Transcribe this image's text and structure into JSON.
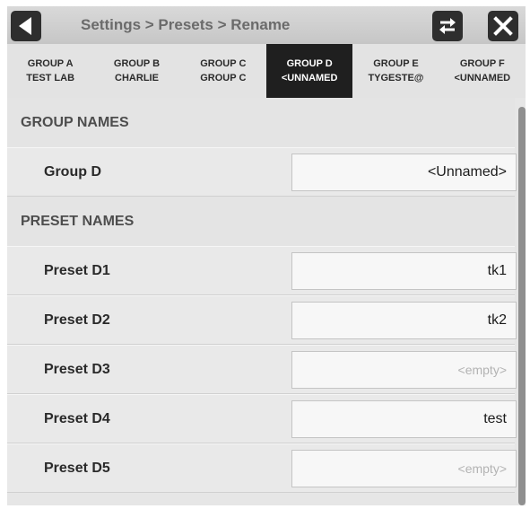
{
  "breadcrumb": "Settings > Presets > Rename",
  "icons": {
    "back": "back-arrow-icon",
    "swap": "swap-arrows-icon",
    "close": "close-x-icon"
  },
  "tabs": [
    {
      "line1": "GROUP A",
      "line2": "TEST LAB",
      "active": false
    },
    {
      "line1": "GROUP B",
      "line2": "CHARLIE",
      "active": false
    },
    {
      "line1": "GROUP C",
      "line2": "GROUP C",
      "active": false
    },
    {
      "line1": "GROUP D",
      "line2": "<UNNAMED",
      "active": true
    },
    {
      "line1": "GROUP E",
      "line2": "TYGESTE@",
      "active": false
    },
    {
      "line1": "GROUP F",
      "line2": "<UNNAMED",
      "active": false
    }
  ],
  "group_names": {
    "header": "GROUP NAMES",
    "rows": [
      {
        "label": "Group D",
        "value": "<Unnamed>",
        "placeholder": ""
      }
    ]
  },
  "preset_names": {
    "header": "PRESET NAMES",
    "rows": [
      {
        "label": "Preset D1",
        "value": "tk1",
        "placeholder": ""
      },
      {
        "label": "Preset D2",
        "value": "tk2",
        "placeholder": ""
      },
      {
        "label": "Preset D3",
        "value": "",
        "placeholder": "<empty>"
      },
      {
        "label": "Preset D4",
        "value": "test",
        "placeholder": ""
      },
      {
        "label": "Preset D5",
        "value": "",
        "placeholder": "<empty>"
      }
    ]
  },
  "colors": {
    "active_tab": "#1f1f1f",
    "button_dark": "#2e2e2e"
  }
}
